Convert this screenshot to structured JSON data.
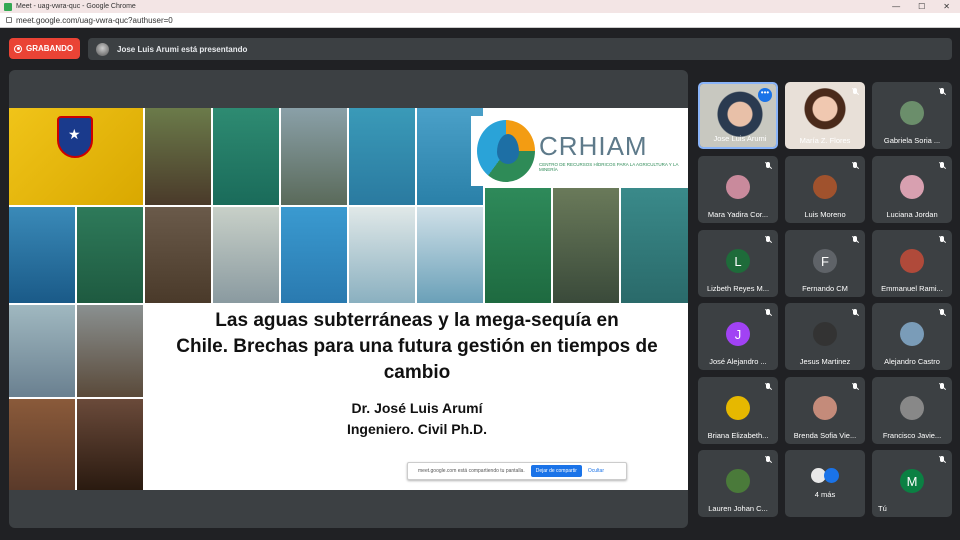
{
  "browser": {
    "window_title": "Meet - uag-vwra-quc - Google Chrome",
    "url": "meet.google.com/uag-vwra-quc?authuser=0",
    "minimize": "—",
    "maximize": "☐",
    "close": "✕"
  },
  "meeting": {
    "recording_label": "GRABANDO",
    "presenting_text": "Jose Luis Arumi está presentando"
  },
  "slide": {
    "logo_title": "CRHIAM",
    "logo_subtitle": "CENTRO DE RECURSOS HÍDRICOS PARA LA AGRICULTURA Y LA MINERÍA",
    "title_line1": "Las aguas subterráneas y la mega-sequía en",
    "title_line2": "Chile.  Brechas para una futura gestión en tiempos de",
    "title_line3": "cambio",
    "author": "Dr. José Luis Arumí",
    "role": "Ingeniero. Civil Ph.D."
  },
  "share_bar": {
    "text": "meet.google.com está compartiendo tu pantalla.",
    "stop_label": "Dejar de compartir",
    "hide_label": "Ocultar"
  },
  "participants": [
    {
      "name": "Jose Luis Arumi",
      "type": "video",
      "active": true
    },
    {
      "name": "María Z. Flores",
      "type": "video"
    },
    {
      "name": "Gabriela Soria ...",
      "type": "photo",
      "color": "#6b8e6b"
    },
    {
      "name": "Mara Yadira Cor...",
      "type": "photo",
      "color": "#c98a9c"
    },
    {
      "name": "Luis Moreno",
      "type": "photo",
      "color": "#a0522d"
    },
    {
      "name": "Luciana Jordan",
      "type": "photo",
      "color": "#d8a0b0"
    },
    {
      "name": "Lizbeth Reyes M...",
      "type": "letter",
      "letter": "L",
      "color": "#1e6b3a"
    },
    {
      "name": "Fernando CM",
      "type": "letter",
      "letter": "F",
      "color": "#5f6368"
    },
    {
      "name": "Emmanuel Rami...",
      "type": "photo",
      "color": "#b04a3a"
    },
    {
      "name": "José Alejandro ...",
      "type": "letter",
      "letter": "J",
      "color": "#a142f4"
    },
    {
      "name": "Jesus Martinez",
      "type": "photo",
      "color": "#333333"
    },
    {
      "name": "Alejandro Castro",
      "type": "photo",
      "color": "#7a9cb8"
    },
    {
      "name": "Briana Elizabeth...",
      "type": "photo",
      "color": "#e6b800"
    },
    {
      "name": "Brenda Sofia Vie...",
      "type": "photo",
      "color": "#c48b7a"
    },
    {
      "name": "Francisco Javie...",
      "type": "photo",
      "color": "#888888"
    },
    {
      "name": "Lauren Johan C...",
      "type": "photo",
      "color": "#4a7a3a"
    },
    {
      "name": "4 más",
      "type": "more"
    },
    {
      "name": "Tú",
      "type": "letter",
      "letter": "M",
      "color": "#0b8043"
    }
  ]
}
